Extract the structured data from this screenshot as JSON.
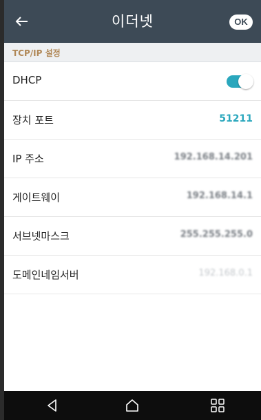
{
  "header": {
    "title": "이더넷",
    "ok_label": "OK"
  },
  "section": {
    "title": "TCP/IP 설정"
  },
  "rows": [
    {
      "label": "DHCP",
      "toggle_on": true
    },
    {
      "label": "장치 포트",
      "value": "51211"
    },
    {
      "label": "IP 주소",
      "value": "192.168.14.201"
    },
    {
      "label": "게이트웨이",
      "value": "192.168.14.1"
    },
    {
      "label": "서브넷마스크",
      "value": "255.255.255.0"
    },
    {
      "label": "도메인네임서버",
      "value": "192.168.0.1"
    }
  ],
  "icons": {
    "back": "arrow-left-icon",
    "nav_back": "triangle-back-icon",
    "nav_home": "home-icon",
    "nav_recents": "recents-grid-icon"
  },
  "colors": {
    "header_bg": "#3d4a56",
    "accent": "#2aa7bd",
    "section_text": "#b08756"
  }
}
